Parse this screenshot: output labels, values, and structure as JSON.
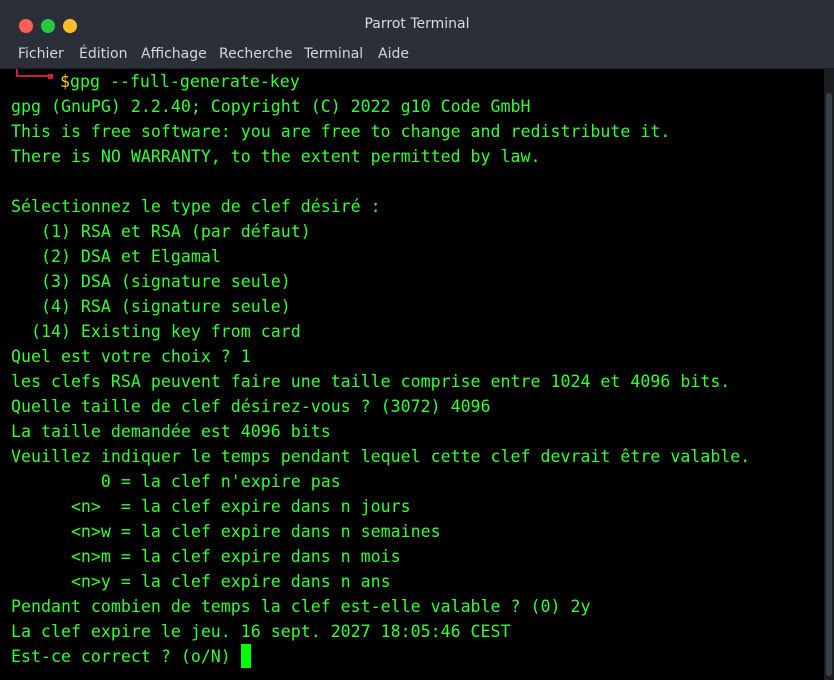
{
  "window": {
    "title": "Parrot Terminal"
  },
  "menu": {
    "items": [
      "Fichier",
      "Édition",
      "Affichage",
      "Recherche",
      "Terminal",
      "Aide"
    ]
  },
  "terminal": {
    "prompt": {
      "symbol": "$",
      "command": "gpg --full-generate-key"
    },
    "lines": [
      "gpg (GnuPG) 2.2.40; Copyright (C) 2022 g10 Code GmbH",
      "This is free software: you are free to change and redistribute it.",
      "There is NO WARRANTY, to the extent permitted by law.",
      "",
      "Sélectionnez le type de clef désiré :",
      "   (1) RSA et RSA (par défaut)",
      "   (2) DSA et Elgamal",
      "   (3) DSA (signature seule)",
      "   (4) RSA (signature seule)",
      "  (14) Existing key from card",
      "Quel est votre choix ? 1",
      "les clefs RSA peuvent faire une taille comprise entre 1024 et 4096 bits.",
      "Quelle taille de clef désirez-vous ? (3072) 4096",
      "La taille demandée est 4096 bits",
      "Veuillez indiquer le temps pendant lequel cette clef devrait être valable.",
      "         0 = la clef n'expire pas",
      "      <n>  = la clef expire dans n jours",
      "      <n>w = la clef expire dans n semaines",
      "      <n>m = la clef expire dans n mois",
      "      <n>y = la clef expire dans n ans",
      "Pendant combien de temps la clef est-elle valable ? (0) 2y",
      "La clef expire le jeu. 16 sept. 2027 18:05:46 CEST",
      "Est-ce correct ? (o/N) "
    ]
  },
  "colors": {
    "terminal_text": "#33ff33",
    "terminal_bg": "#000000",
    "prompt_dollar": "#ffcc00",
    "prompt_corner": "#cc2030",
    "cursor": "#00ff00",
    "close_button": "#ff5f57",
    "minimize_button": "#28c940",
    "maximize_button": "#ffbd2e"
  }
}
